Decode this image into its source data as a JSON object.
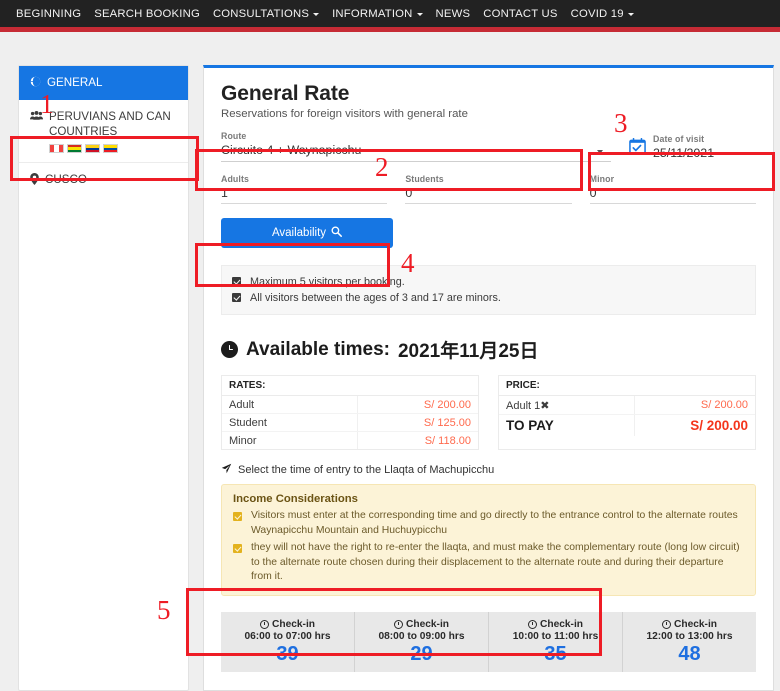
{
  "navbar": {
    "items": [
      {
        "label": "BEGINNING",
        "has_caret": false
      },
      {
        "label": "SEARCH BOOKING",
        "has_caret": false
      },
      {
        "label": "CONSULTATIONS",
        "has_caret": true
      },
      {
        "label": "INFORMATION",
        "has_caret": true
      },
      {
        "label": "NEWS",
        "has_caret": false
      },
      {
        "label": "CONTACT US",
        "has_caret": false
      },
      {
        "label": "COVID 19",
        "has_caret": true
      }
    ],
    "background": "#222222",
    "stripe_color": "#c62b35"
  },
  "sidebar": {
    "items": [
      {
        "label": "GENERAL",
        "icon": "globe-icon",
        "icon_glyph": "🌐",
        "active": true
      },
      {
        "label": "PERUVIANS AND CAN COUNTRIES",
        "icon": "users-icon",
        "icon_glyph": "👥",
        "active": false
      },
      {
        "label": "CUSCO",
        "icon": "map-marker-icon",
        "icon_glyph": "📍",
        "active": false
      }
    ],
    "flags": [
      {
        "name": "peru-flag",
        "orientation": "vertical",
        "colors": [
          "#f1413f",
          "#ffffff",
          "#f1413f"
        ]
      },
      {
        "name": "bolivia-flag",
        "orientation": "horizontal",
        "colors": [
          "#d52b1e",
          "#f9e300",
          "#007a33"
        ]
      },
      {
        "name": "colombia-flag",
        "orientation": "horizontal",
        "colors": [
          "#fcd116",
          "#003893",
          "#ce1126"
        ]
      },
      {
        "name": "ecuador-flag",
        "orientation": "horizontal",
        "colors": [
          "#ffdd00",
          "#034ea2",
          "#ed1c24"
        ]
      }
    ],
    "active_color": "#1676e3"
  },
  "card": {
    "title": "General Rate",
    "subtitle": "Reservations for foreign visitors with general rate",
    "accent_color": "#1676e3"
  },
  "form": {
    "route": {
      "label": "Route",
      "value": "Circuito 4 + Waynapicchu"
    },
    "date_of_visit": {
      "label": "Date of visit",
      "value": "25/11/2021",
      "icon": "calendar-check-icon"
    },
    "counts": [
      {
        "label": "Adults",
        "value": "1"
      },
      {
        "label": "Students",
        "value": "0"
      },
      {
        "label": "Minor",
        "value": "0"
      }
    ],
    "availability_button": {
      "label": "Availability",
      "icon": "search-icon",
      "color": "#1676e3"
    }
  },
  "notes": [
    "Maximum 5 visitors per booking.",
    "All visitors between the ages of 3 and 17 are minors."
  ],
  "available_times": {
    "heading_prefix": "Available times:",
    "heading_date": "2021年11月25日",
    "icon": "clock-icon"
  },
  "rates_table": {
    "header": "RATES:",
    "rows": [
      {
        "label": "Adult",
        "amount": "S/ 200.00"
      },
      {
        "label": "Student",
        "amount": "S/ 125.00"
      },
      {
        "label": "Minor",
        "amount": "S/ 118.00"
      }
    ],
    "amount_color": "#ff6a4d"
  },
  "price_table": {
    "header": "PRICE:",
    "rows": [
      {
        "label": "Adult 1✖",
        "amount": "S/ 200.00",
        "total": false
      },
      {
        "label": "TO PAY",
        "amount": "S/ 200.00",
        "total": true
      }
    ],
    "total_color": "#f4351c"
  },
  "select_entry_text": "Select the time of entry to the Llaqta of Machupicchu",
  "income": {
    "title": "Income Considerations",
    "lines": [
      "Visitors must enter at the corresponding time and go directly to the entrance control to the alternate routes Waynapicchu Mountain and Huchuypicchu",
      "they will not have the right to re-enter the llaqta, and must make the complementary route (long low circuit) to the alternate route chosen during their displacement to the alternate route and during their departure from it."
    ],
    "background": "#fcf3d7"
  },
  "slots": {
    "checkin_label": "Check-in",
    "items": [
      {
        "range": "06:00 to 07:00 hrs",
        "count": "39"
      },
      {
        "range": "08:00 to 09:00 hrs",
        "count": "29"
      },
      {
        "range": "10:00 to 11:00 hrs",
        "count": "35"
      },
      {
        "range": "12:00 to 13:00 hrs",
        "count": "48"
      }
    ],
    "count_color": "#1e6fe0"
  },
  "annotations": [
    {
      "number": "1"
    },
    {
      "number": "2"
    },
    {
      "number": "3"
    },
    {
      "number": "4"
    },
    {
      "number": "5"
    }
  ]
}
